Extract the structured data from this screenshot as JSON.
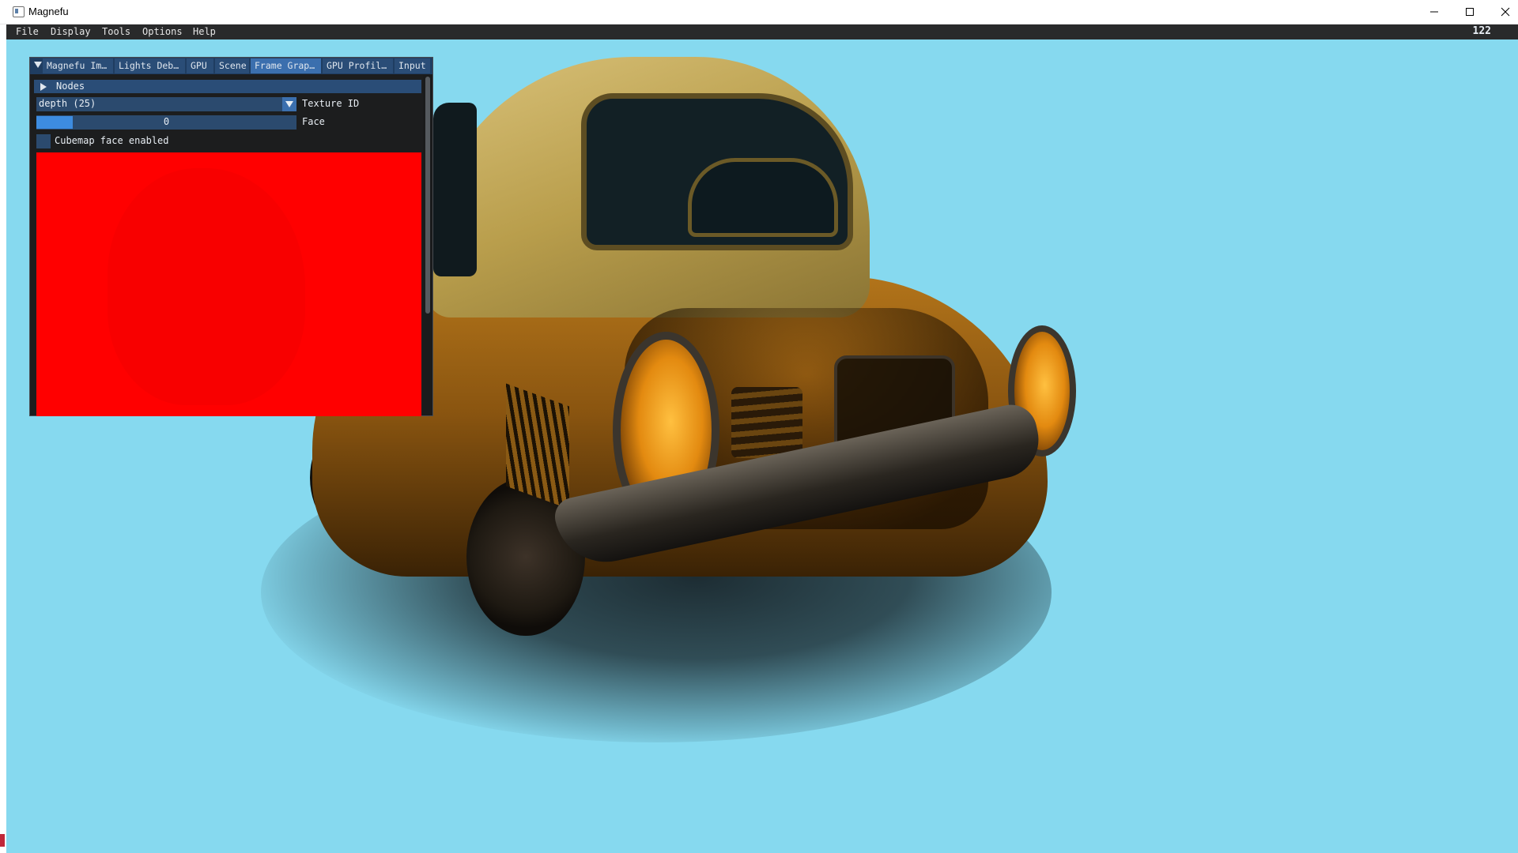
{
  "window": {
    "title": "Magnefu",
    "controls": {
      "minimize": "minimize",
      "maximize": "maximize",
      "close": "close"
    }
  },
  "menubar": {
    "items": [
      "File",
      "Display",
      "Tools",
      "Options",
      "Help"
    ],
    "fps": "122"
  },
  "imgui": {
    "tabs": [
      "Magnefu Im…",
      "Lights Deb…",
      "GPU",
      "Scene",
      "Frame Grap…",
      "GPU Profil…",
      "Input"
    ],
    "active_tab": "Frame Grap…",
    "nodes_header": "Nodes",
    "texture_combo": {
      "value": "depth (25)",
      "label": "Texture ID"
    },
    "face_slider": {
      "value": "0",
      "label": "Face",
      "fill_fraction": 0.14
    },
    "cubemap_checkbox": {
      "label": "Cubemap face enabled",
      "checked": false
    },
    "preview_color": "#ff0000"
  },
  "colors": {
    "viewport_background": "#86d9ef",
    "imgui_accent": "#3b6fae",
    "menubar_bg": "#292a2b"
  }
}
